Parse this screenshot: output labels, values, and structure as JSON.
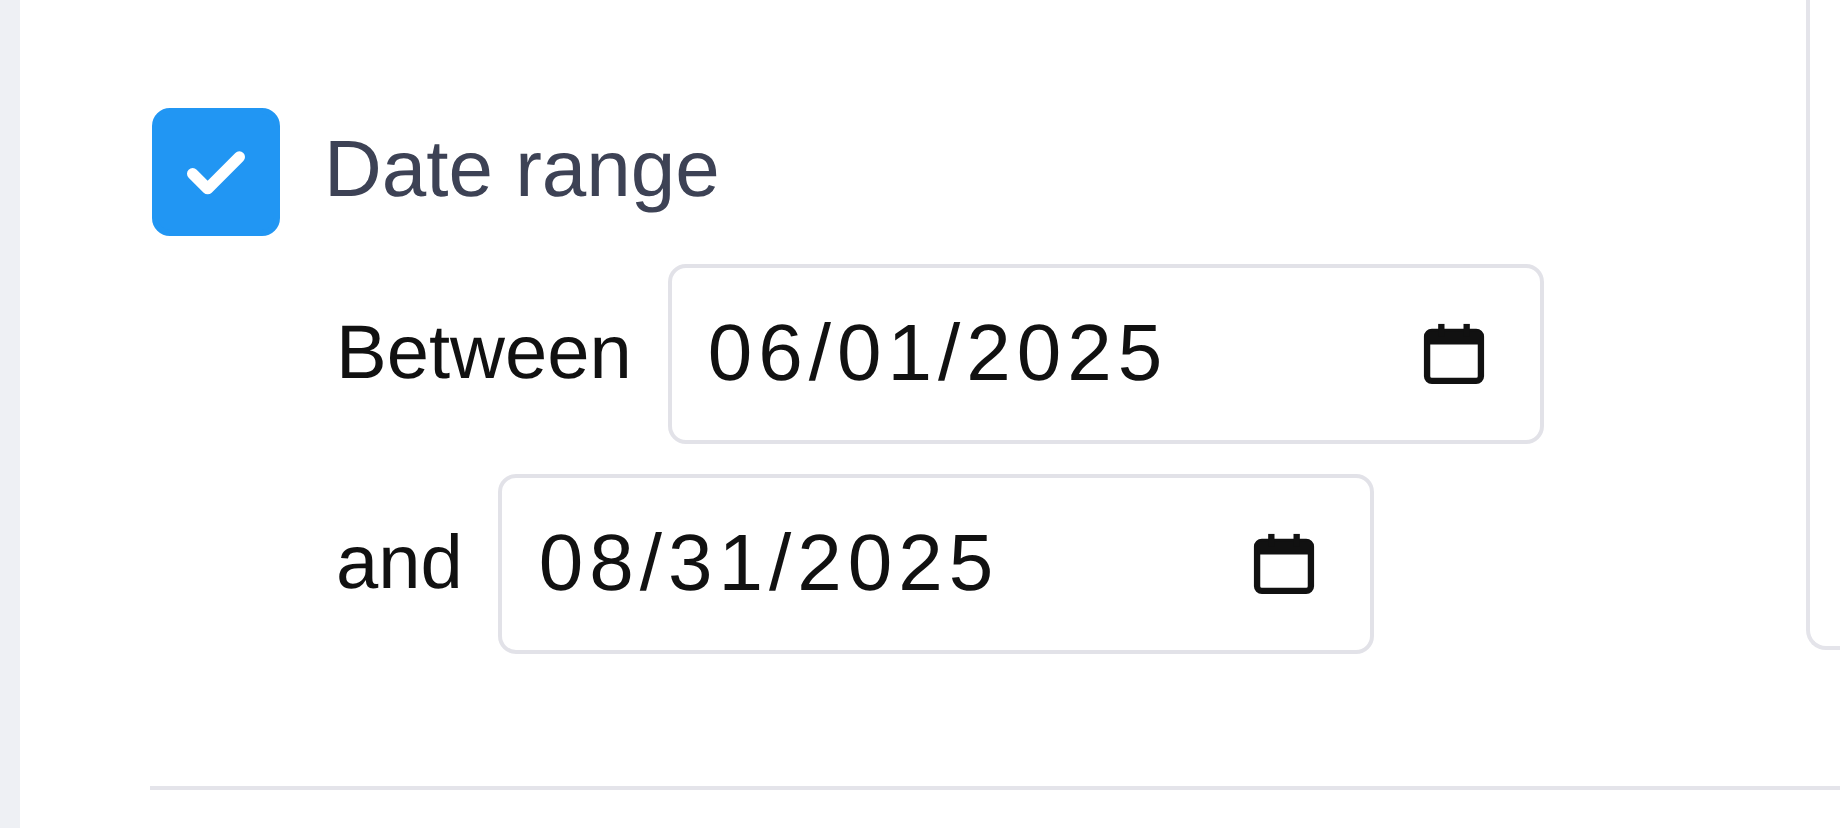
{
  "date_range": {
    "label": "Date range",
    "checked": true,
    "rows": [
      {
        "label": "Between",
        "value": "06/01/2025"
      },
      {
        "label": "and",
        "value": "08/31/2025"
      }
    ]
  }
}
